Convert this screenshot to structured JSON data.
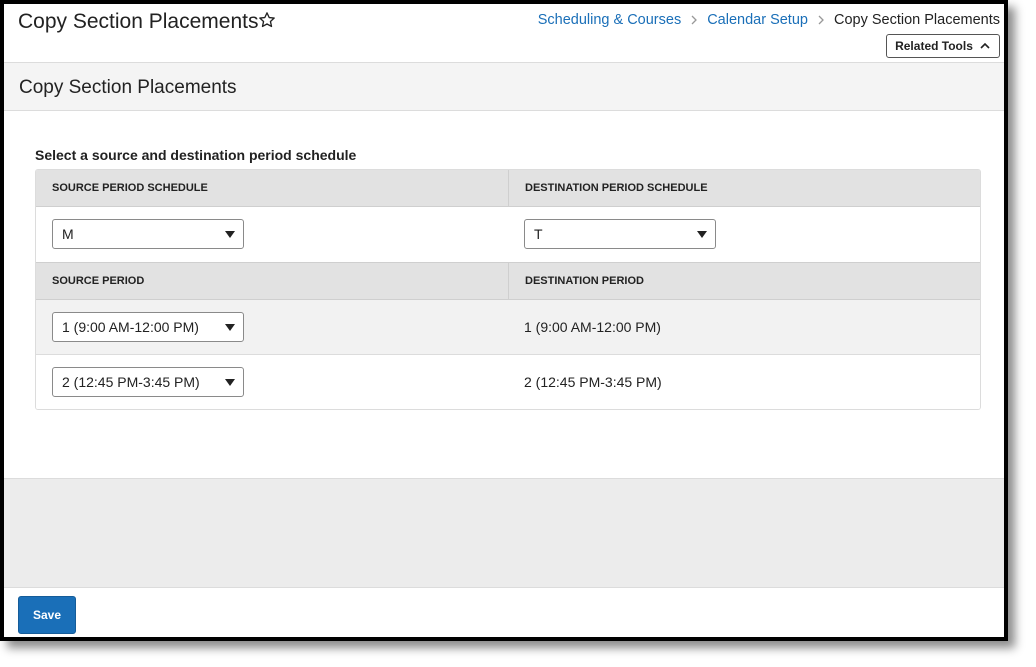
{
  "header": {
    "title": "Copy Section Placements",
    "breadcrumb": [
      "Scheduling & Courses",
      "Calendar Setup",
      "Copy Section Placements"
    ],
    "related_tools_label": "Related Tools"
  },
  "section": {
    "title": "Copy Section Placements",
    "instructions": "Select a source and destination period schedule"
  },
  "table": {
    "schedule_headers": [
      "SOURCE PERIOD SCHEDULE",
      "DESTINATION PERIOD SCHEDULE"
    ],
    "source_schedule_value": "M",
    "destination_schedule_value": "T",
    "period_headers": [
      "SOURCE PERIOD",
      "DESTINATION PERIOD"
    ],
    "periods": [
      {
        "source": "1 (9:00 AM-12:00 PM)",
        "destination": "1 (9:00 AM-12:00 PM)"
      },
      {
        "source": "2 (12:45 PM-3:45 PM)",
        "destination": "2 (12:45 PM-3:45 PM)"
      }
    ]
  },
  "footer": {
    "save_label": "Save"
  },
  "colors": {
    "link": "#1a6fb8",
    "primary_button": "#1a6fb8",
    "header_row": "#e2e2e2"
  }
}
